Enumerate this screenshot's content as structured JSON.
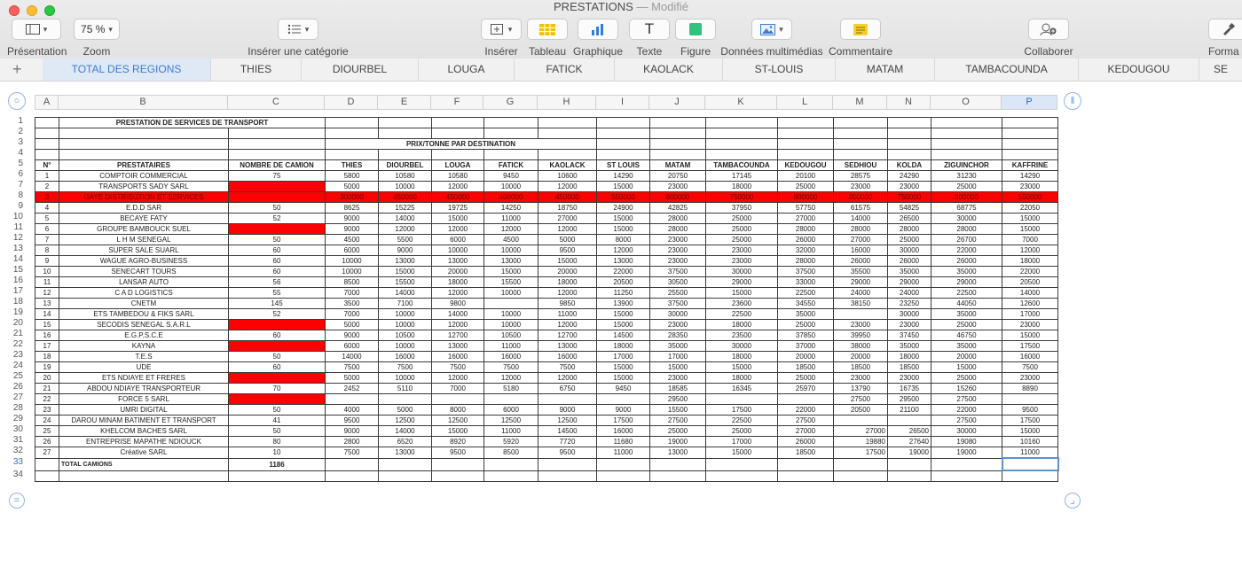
{
  "window": {
    "title": "PRESTATIONS",
    "status": "— Modifié"
  },
  "toolbar": {
    "presentation": {
      "label": "Présentation",
      "icon": "sidebar-icon"
    },
    "zoom": {
      "label": "Zoom",
      "value": "75 %"
    },
    "category": {
      "label": "Insérer une catégorie",
      "icon": "list-icon"
    },
    "insert": {
      "label": "Insérer",
      "icon": "insert-plus-icon"
    },
    "table": {
      "label": "Tableau",
      "icon": "table-icon"
    },
    "chart": {
      "label": "Graphique",
      "icon": "bar-chart-icon"
    },
    "text": {
      "label": "Texte",
      "glyph": "T"
    },
    "shape": {
      "label": "Figure",
      "icon": "square-icon"
    },
    "media": {
      "label": "Données multimédias",
      "icon": "image-icon"
    },
    "comment": {
      "label": "Commentaire",
      "icon": "comment-icon"
    },
    "collab": {
      "label": "Collaborer",
      "icon": "person-plus-icon"
    },
    "format": {
      "label": "Forma",
      "icon": "brush-icon"
    }
  },
  "tabs": [
    "TOTAL DES REGIONS",
    "THIES",
    "DIOURBEL",
    "LOUGA",
    "FATICK",
    "KAOLACK",
    "ST-LOUIS",
    "MATAM",
    "TAMBACOUNDA",
    "KEDOUGOU",
    "SE"
  ],
  "colors": {
    "accent": "#3d7bd0",
    "red_fill": "#ff0000",
    "tab_active_bg": "#dfe9f6"
  },
  "columns": [
    "A",
    "B",
    "C",
    "D",
    "E",
    "F",
    "G",
    "H",
    "I",
    "J",
    "K",
    "L",
    "M",
    "N",
    "O",
    "P"
  ],
  "row_numbers": [
    "1",
    "2",
    "3",
    "4",
    "5",
    "6",
    "7",
    "8",
    "9",
    "10",
    "11",
    "12",
    "13",
    "14",
    "15",
    "16",
    "17",
    "18",
    "19",
    "20",
    "21",
    "22",
    "23",
    "24",
    "25",
    "26",
    "27",
    "28",
    "29",
    "30",
    "31",
    "32",
    "33",
    "34"
  ],
  "sheet": {
    "title": "PRESTATION DE SERVICES DE TRANSPORT",
    "subtitle": "PRIX/TONNE PAR DESTINATION",
    "headers": [
      "N°",
      "PRESTATAIRES",
      "NOMBRE DE CAMION",
      "THIES",
      "DIOURBEL",
      "LOUGA",
      "FATICK",
      "KAOLACK",
      "ST LOUIS",
      "MATAM",
      "TAMBACOUNDA",
      "KEDOUGOU",
      "SEDHIOU",
      "KOLDA",
      "ZIGUINCHOR",
      "KAFFRINE"
    ],
    "rows": [
      [
        "1",
        "COMPTOIR COMMERCIAL",
        "75",
        "5800",
        "10580",
        "10580",
        "9450",
        "10600",
        "14290",
        "20750",
        "17145",
        "20100",
        "28575",
        "24290",
        "31230",
        "14290"
      ],
      [
        "2",
        "TRANSPORTS SADY SARL",
        "",
        "5000",
        "10000",
        "12000",
        "10000",
        "12000",
        "15000",
        "23000",
        "18000",
        "25000",
        "23000",
        "23000",
        "25000",
        "23000"
      ],
      [
        "3",
        "GAYE DISTRIBUTION ET SERVICES",
        "",
        "300000",
        "450000",
        "450000",
        "400000",
        "450000",
        "550000",
        "800000",
        "750000",
        "800000",
        "800000",
        "750000",
        "800000",
        "550000"
      ],
      [
        "4",
        "E.D.D SAR",
        "50",
        "8625",
        "15225",
        "19725",
        "14250",
        "18750",
        "24900",
        "42825",
        "37950",
        "57750",
        "61575",
        "54825",
        "68775",
        "22050"
      ],
      [
        "5",
        "BECAYE FATY",
        "52",
        "9000",
        "14000",
        "15000",
        "11000",
        "27000",
        "15000",
        "28000",
        "25000",
        "27000",
        "14000",
        "26500",
        "30000",
        "15000"
      ],
      [
        "6",
        "GROUPE BAMBOUCK SUEL",
        "",
        "9000",
        "12000",
        "12000",
        "12000",
        "12000",
        "15000",
        "28000",
        "25000",
        "28000",
        "28000",
        "28000",
        "28000",
        "15000"
      ],
      [
        "7",
        "L H M SENEGAL",
        "50",
        "4500",
        "5500",
        "6000",
        "4500",
        "5000",
        "8000",
        "23000",
        "25000",
        "26000",
        "27000",
        "25000",
        "26700",
        "7000"
      ],
      [
        "8",
        "SUPER  SALE SUARL",
        "60",
        "6000",
        "9000",
        "10000",
        "10000",
        "9500",
        "12000",
        "23000",
        "23000",
        "32000",
        "16000",
        "30000",
        "22000",
        "12000"
      ],
      [
        "9",
        "WAGUE AGRO-BUSINESS",
        "60",
        "10000",
        "13000",
        "13000",
        "13000",
        "15000",
        "13000",
        "23000",
        "23000",
        "28000",
        "26000",
        "26000",
        "26000",
        "18000"
      ],
      [
        "10",
        "SENECART  TOURS",
        "60",
        "10000",
        "15000",
        "20000",
        "15000",
        "20000",
        "22000",
        "37500",
        "30000",
        "37500",
        "35500",
        "35000",
        "35000",
        "22000"
      ],
      [
        "11",
        "LANSAR AUTO",
        "56",
        "8500",
        "15500",
        "18000",
        "15500",
        "18000",
        "20500",
        "30500",
        "29000",
        "33000",
        "29000",
        "29000",
        "29000",
        "20500"
      ],
      [
        "12",
        "C A D LOGISTICS",
        "55",
        "7000",
        "14000",
        "12000",
        "10000",
        "12000",
        "11250",
        "25500",
        "15000",
        "22500",
        "24000",
        "24000",
        "22500",
        "14000"
      ],
      [
        "13",
        "CNETM",
        "145",
        "3500",
        "7100",
        "9800",
        "",
        "9850",
        "13900",
        "37500",
        "23600",
        "34550",
        "38150",
        "23250",
        "44050",
        "12600"
      ],
      [
        "14",
        "ETS TAMBEDOU & FIKS SARL",
        "52",
        "7000",
        "10000",
        "14000",
        "10000",
        "11000",
        "15000",
        "30000",
        "22500",
        "35000",
        "",
        "30000",
        "35000",
        "17000"
      ],
      [
        "15",
        "SECODIS  SENEGAL  S.A.R.L",
        "",
        "5000",
        "10000",
        "12000",
        "10000",
        "12000",
        "15000",
        "23000",
        "18000",
        "25000",
        "23000",
        "23000",
        "25000",
        "23000"
      ],
      [
        "16",
        "E.G.P.S.C.E",
        "60",
        "9000",
        "10500",
        "12700",
        "10500",
        "12700",
        "14500",
        "28350",
        "23500",
        "37850",
        "39950",
        "37450",
        "46750",
        "15000"
      ],
      [
        "17",
        "KAYNA",
        "",
        "6000",
        "10000",
        "13000",
        "11000",
        "13000",
        "18000",
        "35000",
        "30000",
        "37000",
        "38000",
        "35000",
        "35000",
        "17500"
      ],
      [
        "18",
        "T.E.S",
        "50",
        "14000",
        "16000",
        "16000",
        "16000",
        "16000",
        "17000",
        "17000",
        "18000",
        "20000",
        "20000",
        "18000",
        "20000",
        "16000"
      ],
      [
        "19",
        "UDE",
        "60",
        "7500",
        "7500",
        "7500",
        "7500",
        "7500",
        "15000",
        "15000",
        "15000",
        "18500",
        "18500",
        "18500",
        "15000",
        "7500"
      ],
      [
        "20",
        "ETS NDIAYE ET FRERES",
        "",
        "5000",
        "10000",
        "12000",
        "12000",
        "12000",
        "15000",
        "23000",
        "18000",
        "25000",
        "23000",
        "23000",
        "25000",
        "23000"
      ],
      [
        "21",
        "ABDOU NDIAYE TRANSPORTEUR",
        "70",
        "2452",
        "5110",
        "7000",
        "5180",
        "6750",
        "9450",
        "18585",
        "16345",
        "25970",
        "13790",
        "16735",
        "15260",
        "8890"
      ],
      [
        "22",
        "FORCE 5 SARL",
        "",
        "",
        "",
        "",
        "",
        "",
        "",
        "29500",
        "",
        "",
        "27500",
        "29500",
        "27500",
        ""
      ],
      [
        "23",
        "UMRI DIGITAL",
        "50",
        "4000",
        "5000",
        "8000",
        "6000",
        "9000",
        "9000",
        "15500",
        "17500",
        "22000",
        "20500",
        "21100",
        "22000",
        "9500"
      ],
      [
        "24",
        "DAROU MINAM BATIMENT ET TRANSPORT",
        "41",
        "9500",
        "12500",
        "12500",
        "12500",
        "12500",
        "17500",
        "27500",
        "22500",
        "27500",
        "",
        "",
        "27500",
        "17500"
      ],
      [
        "25",
        "KHELCOM BACHES SARL",
        "50",
        "9000",
        "14000",
        "15000",
        "11000",
        "14500",
        "16000",
        "25000",
        "25000",
        "27000",
        "27000",
        "26500",
        "30000",
        "15000"
      ],
      [
        "26",
        "ENTREPRISE MAPATHE NDIOUCK",
        "80",
        "2800",
        "6520",
        "8920",
        "5920",
        "7720",
        "11680",
        "19000",
        "17000",
        "26000",
        "19880",
        "27640",
        "19080",
        "10160"
      ],
      [
        "27",
        "Créative SARL",
        "10",
        "7500",
        "13000",
        "9500",
        "8500",
        "9500",
        "11000",
        "13000",
        "15000",
        "18500",
        "17500",
        "19000",
        "19000",
        "11000"
      ]
    ],
    "total_label": "TOTAL CAMIONS",
    "total_value": "1186"
  }
}
